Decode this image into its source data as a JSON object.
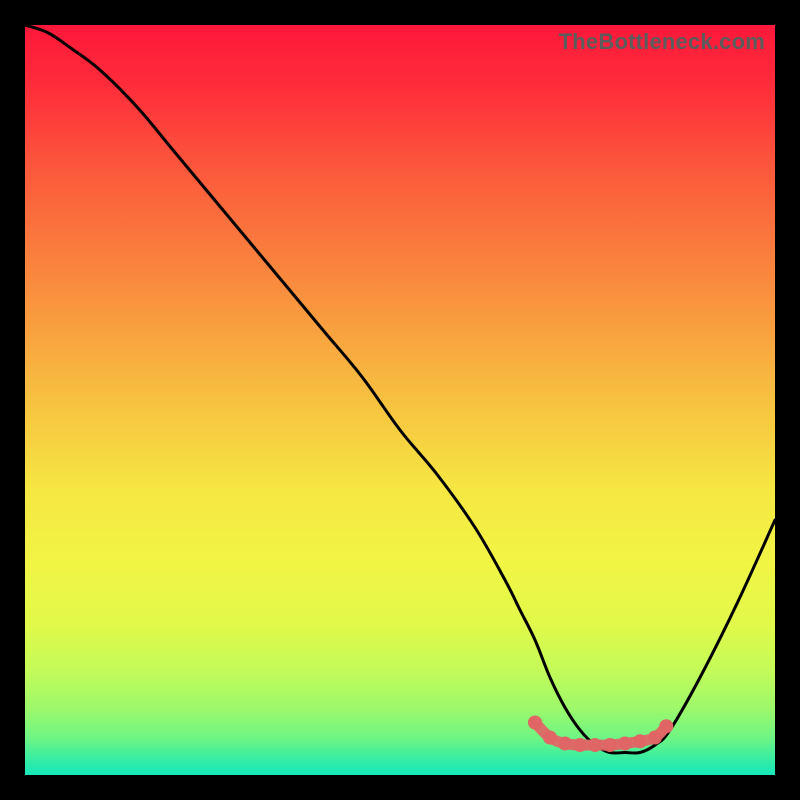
{
  "watermark": "TheBottleneck.com",
  "chart_data": {
    "type": "line",
    "title": "",
    "xlabel": "",
    "ylabel": "",
    "xlim": [
      0,
      100
    ],
    "ylim": [
      0,
      100
    ],
    "series": [
      {
        "name": "curve",
        "x": [
          0,
          3,
          6,
          10,
          15,
          20,
          25,
          30,
          35,
          40,
          45,
          50,
          55,
          60,
          64,
          66,
          68,
          70,
          72,
          74,
          76,
          78,
          80,
          82,
          84,
          86,
          90,
          95,
          100
        ],
        "y": [
          100,
          99,
          97,
          94,
          89,
          83,
          77,
          71,
          65,
          59,
          53,
          46,
          40,
          33,
          26,
          22,
          18,
          13,
          9,
          6,
          4,
          3,
          3,
          3,
          4,
          6,
          13,
          23,
          34
        ]
      }
    ],
    "highlight": {
      "name": "trough-highlight",
      "color": "#e06666",
      "x": [
        68,
        70,
        72,
        74,
        76,
        78,
        80,
        82,
        84,
        85.5
      ],
      "y": [
        7,
        5,
        4.2,
        4,
        4,
        4,
        4.2,
        4.5,
        5.0,
        6.5
      ]
    },
    "gradient_stops": [
      {
        "offset": 0.0,
        "color": "#fe183a"
      },
      {
        "offset": 0.08,
        "color": "#fe2c3a"
      },
      {
        "offset": 0.2,
        "color": "#fc5b3c"
      },
      {
        "offset": 0.35,
        "color": "#f98d3e"
      },
      {
        "offset": 0.5,
        "color": "#f7c140"
      },
      {
        "offset": 0.62,
        "color": "#f6e742"
      },
      {
        "offset": 0.72,
        "color": "#f1f544"
      },
      {
        "offset": 0.8,
        "color": "#e1f94a"
      },
      {
        "offset": 0.86,
        "color": "#c4fa58"
      },
      {
        "offset": 0.91,
        "color": "#9ef96a"
      },
      {
        "offset": 0.95,
        "color": "#6ff583"
      },
      {
        "offset": 0.975,
        "color": "#3eee9f"
      },
      {
        "offset": 1.0,
        "color": "#14e7bb"
      }
    ]
  }
}
